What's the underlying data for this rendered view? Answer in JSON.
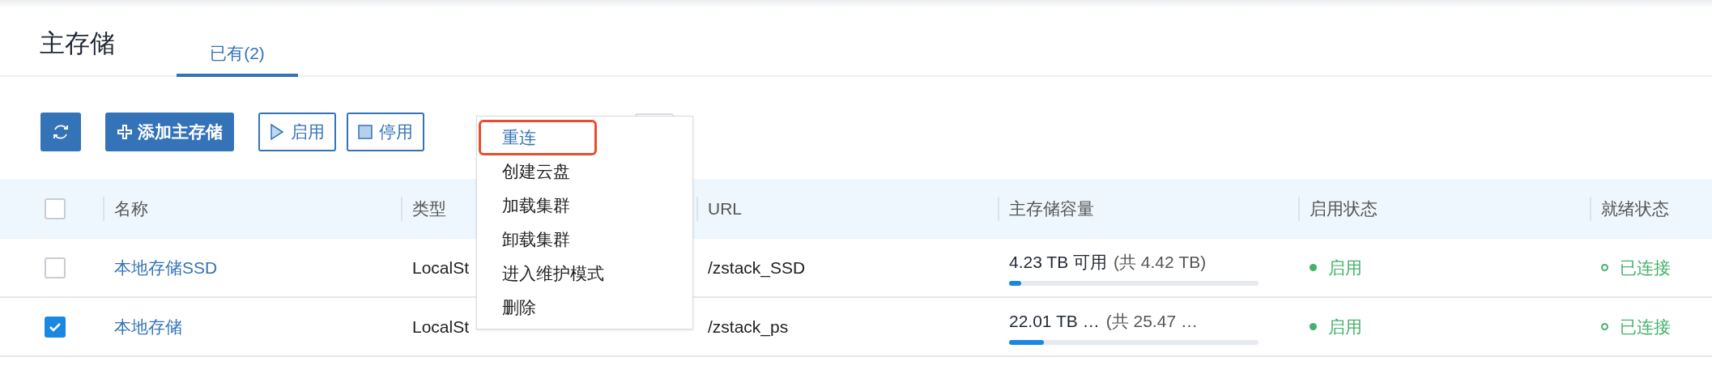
{
  "page": {
    "title": "主存储"
  },
  "tabs": [
    {
      "label": "已有(2)",
      "selected": true
    }
  ],
  "toolbar": [
    {
      "kind": "refresh"
    },
    {
      "kind": "add",
      "label": "添加主存储"
    },
    {
      "kind": "enable",
      "label": "启用"
    },
    {
      "kind": "disable",
      "label": "停用"
    },
    {
      "kind": "more"
    }
  ],
  "menu": {
    "items": [
      {
        "label": "重连",
        "highlighted": true
      },
      {
        "label": "创建云盘",
        "highlighted": false
      },
      {
        "label": "加载集群",
        "highlighted": false
      },
      {
        "label": "卸载集群",
        "highlighted": false
      },
      {
        "label": "进入维护模式",
        "highlighted": false
      },
      {
        "label": "删除",
        "highlighted": false
      }
    ]
  },
  "table": {
    "select_all": {
      "checked": false
    },
    "columns": [
      "名称",
      "类型",
      "URL",
      "主存储容量",
      "启用状态",
      "就绪状态"
    ],
    "rows": [
      {
        "checked": false,
        "name": "本地存储SSD",
        "type": "LocalSt",
        "url": "/zstack_SSD",
        "available": "4.23 TB 可用",
        "total": "(共 4.42 TB)",
        "level": 0.05,
        "state": "启用",
        "enabled": true,
        "ready": "已连接",
        "connected": true
      },
      {
        "checked": true,
        "name": "本地存储",
        "type": "LocalSt",
        "url": "/zstack_ps",
        "available": "22.01 TB …",
        "total": "(共 25.47 …",
        "level": 0.14,
        "state": "启用",
        "enabled": true,
        "ready": "已连接",
        "connected": true
      }
    ]
  }
}
